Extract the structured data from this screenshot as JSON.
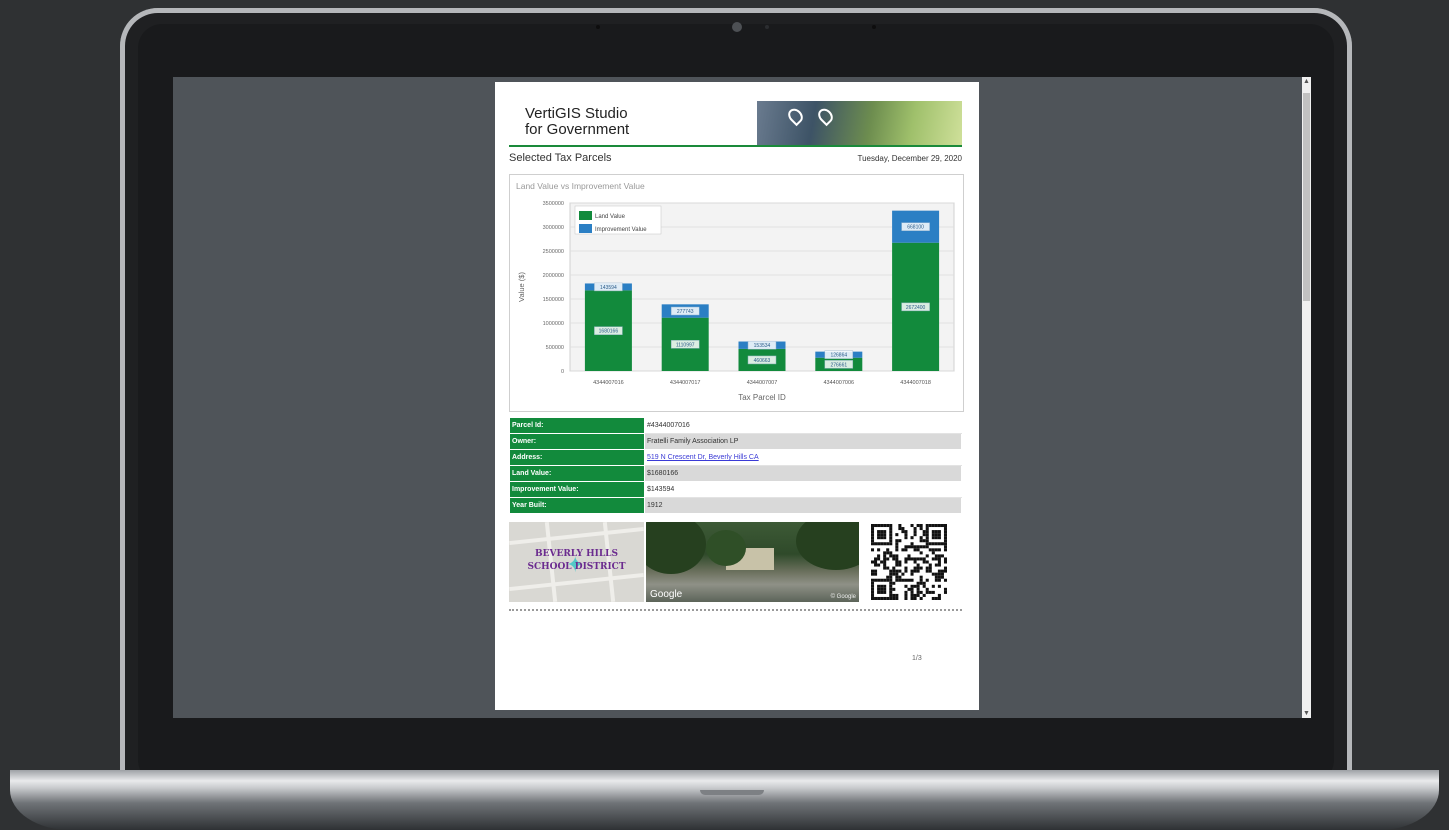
{
  "report": {
    "app_title_line1": "VertiGIS Studio",
    "app_title_line2": "for Government",
    "section_title": "Selected Tax Parcels",
    "date": "Tuesday, December 29, 2020",
    "page_number": "1/3"
  },
  "chart_data": {
    "type": "bar",
    "stacked": true,
    "title": "Land Value vs Improvement Value",
    "xlabel": "Tax Parcel ID",
    "ylabel": "Value ($)",
    "ylim": [
      0,
      3500000
    ],
    "yticks": [
      "0",
      "500000",
      "1000000",
      "1500000",
      "2000000",
      "2500000",
      "3000000",
      "3500000"
    ],
    "categories": [
      "4344007016",
      "4344007017",
      "4344007007",
      "4344007006",
      "4344007018"
    ],
    "series": [
      {
        "name": "Land Value",
        "color": "#128a3c",
        "values": [
          1680166,
          1110997,
          460663,
          276661,
          2672400
        ],
        "labels": [
          "1680166",
          "1110997",
          "460663",
          "276661",
          "2672400"
        ]
      },
      {
        "name": "Improvement Value",
        "color": "#2b7fc4",
        "values": [
          143594,
          277743,
          153534,
          126864,
          668100
        ],
        "labels": [
          "143594",
          "277743",
          "153534",
          "126864",
          "668100"
        ]
      }
    ],
    "legend": "top-left",
    "grid": true
  },
  "attributes": [
    {
      "key": "Parcel Id:",
      "value": "#4344007016"
    },
    {
      "key": "Owner:",
      "value": "Fratelli Family Association LP"
    },
    {
      "key": "Address:",
      "value": "519 N Crescent Dr, Beverly Hills CA"
    },
    {
      "key": "Land Value:",
      "value": "$1680166"
    },
    {
      "key": "Improvement Value:",
      "value": "$143594"
    },
    {
      "key": "Year Built:",
      "value": "1912"
    }
  ],
  "tiles": {
    "district_line1": "BEVERLY HILLS",
    "district_line2": "SCHOOL DISTRICT",
    "photo_brand": "Google",
    "photo_copyright": "© Google"
  },
  "icons": {
    "scroll_up": "scroll-up-arrow-icon",
    "scroll_down": "scroll-down-arrow-icon",
    "banner_pins": "map-pin-icon"
  },
  "colors": {
    "accent_green": "#128a3c",
    "improvement_blue": "#2b7fc4"
  }
}
